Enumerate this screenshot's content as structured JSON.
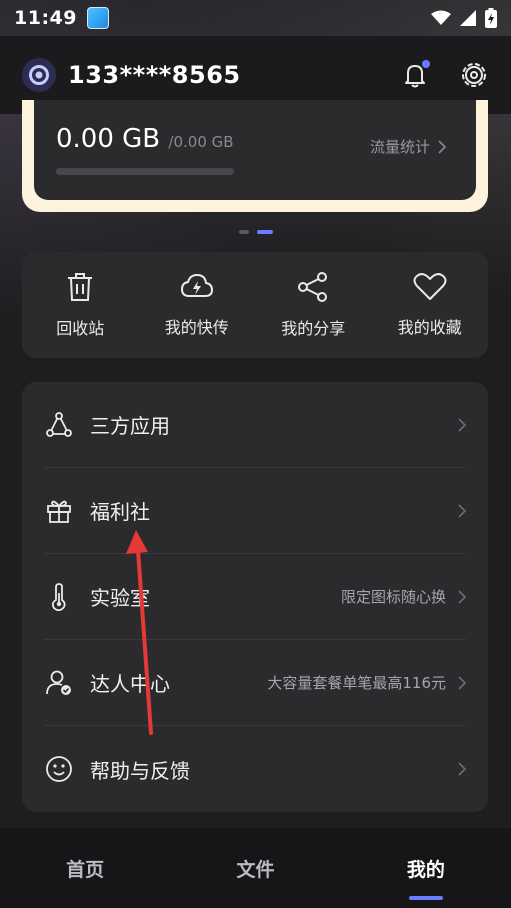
{
  "status_bar": {
    "time": "11:49"
  },
  "header": {
    "phone": "133****8565"
  },
  "storage": {
    "used": "0.00 GB",
    "total": "/0.00 GB",
    "traffic_link": "流量统计",
    "progress": 0
  },
  "quick_actions": [
    {
      "label": "回收站",
      "icon": "trash-icon"
    },
    {
      "label": "我的快传",
      "icon": "cloud-bolt-icon"
    },
    {
      "label": "我的分享",
      "icon": "share-icon"
    },
    {
      "label": "我的收藏",
      "icon": "heart-icon"
    }
  ],
  "menu": [
    {
      "label": "三方应用",
      "sub": "",
      "icon": "third-party-icon"
    },
    {
      "label": "福利社",
      "sub": "",
      "icon": "gift-icon"
    },
    {
      "label": "实验室",
      "sub": "限定图标随心换",
      "icon": "thermometer-icon"
    },
    {
      "label": "达人中心",
      "sub": "大容量套餐单笔最高116元",
      "icon": "user-badge-icon"
    },
    {
      "label": "帮助与反馈",
      "sub": "",
      "icon": "smiley-icon"
    }
  ],
  "tabs": [
    {
      "label": "首页",
      "active": false
    },
    {
      "label": "文件",
      "active": false
    },
    {
      "label": "我的",
      "active": true
    }
  ],
  "colors": {
    "accent": "#6b7cff",
    "background": "#1e1e20",
    "card": "#2b2b2e",
    "annotation": "#e53935"
  }
}
